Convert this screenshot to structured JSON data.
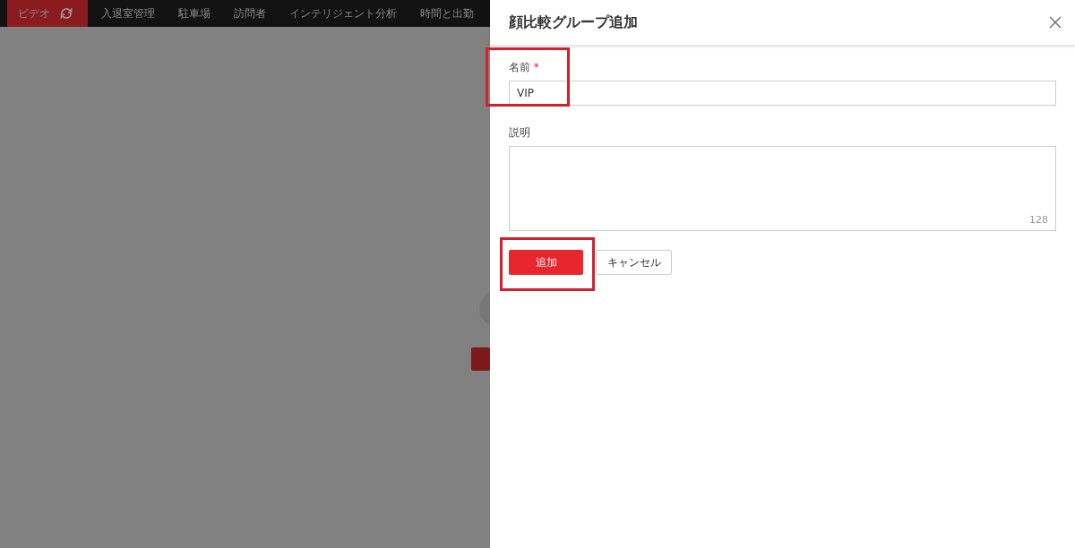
{
  "nav": {
    "tabs": [
      {
        "label": "ビデオ",
        "selected": true
      },
      {
        "label": "入退室管理",
        "selected": false
      },
      {
        "label": "駐車場",
        "selected": false
      },
      {
        "label": "訪問者",
        "selected": false
      },
      {
        "label": "インテリジェント分析",
        "selected": false
      },
      {
        "label": "時間と出勤",
        "selected": false
      }
    ]
  },
  "drawer": {
    "title": "顔比較グループ追加",
    "fields": [
      {
        "kind": "input",
        "label": "名前",
        "required_mark": "*",
        "value": "VIP",
        "highlight": true
      },
      {
        "kind": "textarea",
        "label": "説明",
        "counter": "128",
        "highlight": false
      }
    ],
    "buttons": [
      {
        "label": "追加",
        "primary": true,
        "highlight": true
      },
      {
        "label": "キャンセル",
        "primary": false,
        "highlight": false
      }
    ]
  }
}
